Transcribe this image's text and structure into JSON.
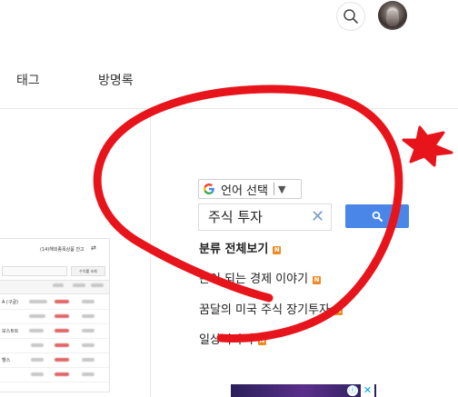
{
  "header": {
    "tabs": [
      {
        "label": "태그"
      },
      {
        "label": "방명록"
      }
    ]
  },
  "table_thumbnail": {
    "title": "(14)해외종목상품 잔고",
    "query_button": "수익률 조회",
    "rows": [
      "A (구글)",
      "모스트트",
      "헬스"
    ]
  },
  "sidebar": {
    "language_selector": {
      "label": "언어 선택",
      "arrow": "▼"
    },
    "search": {
      "value": "주식 투자",
      "clear": "✕"
    },
    "categories": [
      {
        "label": "분류 전체보기",
        "badge": "N",
        "bold": true
      },
      {
        "label": "돈이 되는 경제 이야기",
        "badge": "N"
      },
      {
        "label": "꿈달의 미국 주식 장기투자",
        "badge": "N"
      },
      {
        "label": "일상이야기",
        "badge": "N"
      }
    ]
  },
  "ad": {
    "info": "ⓘ",
    "close": "✕"
  },
  "colors": {
    "annotation": "#e8141b",
    "search_button": "#4a86e8",
    "badge": "#f08a24"
  }
}
